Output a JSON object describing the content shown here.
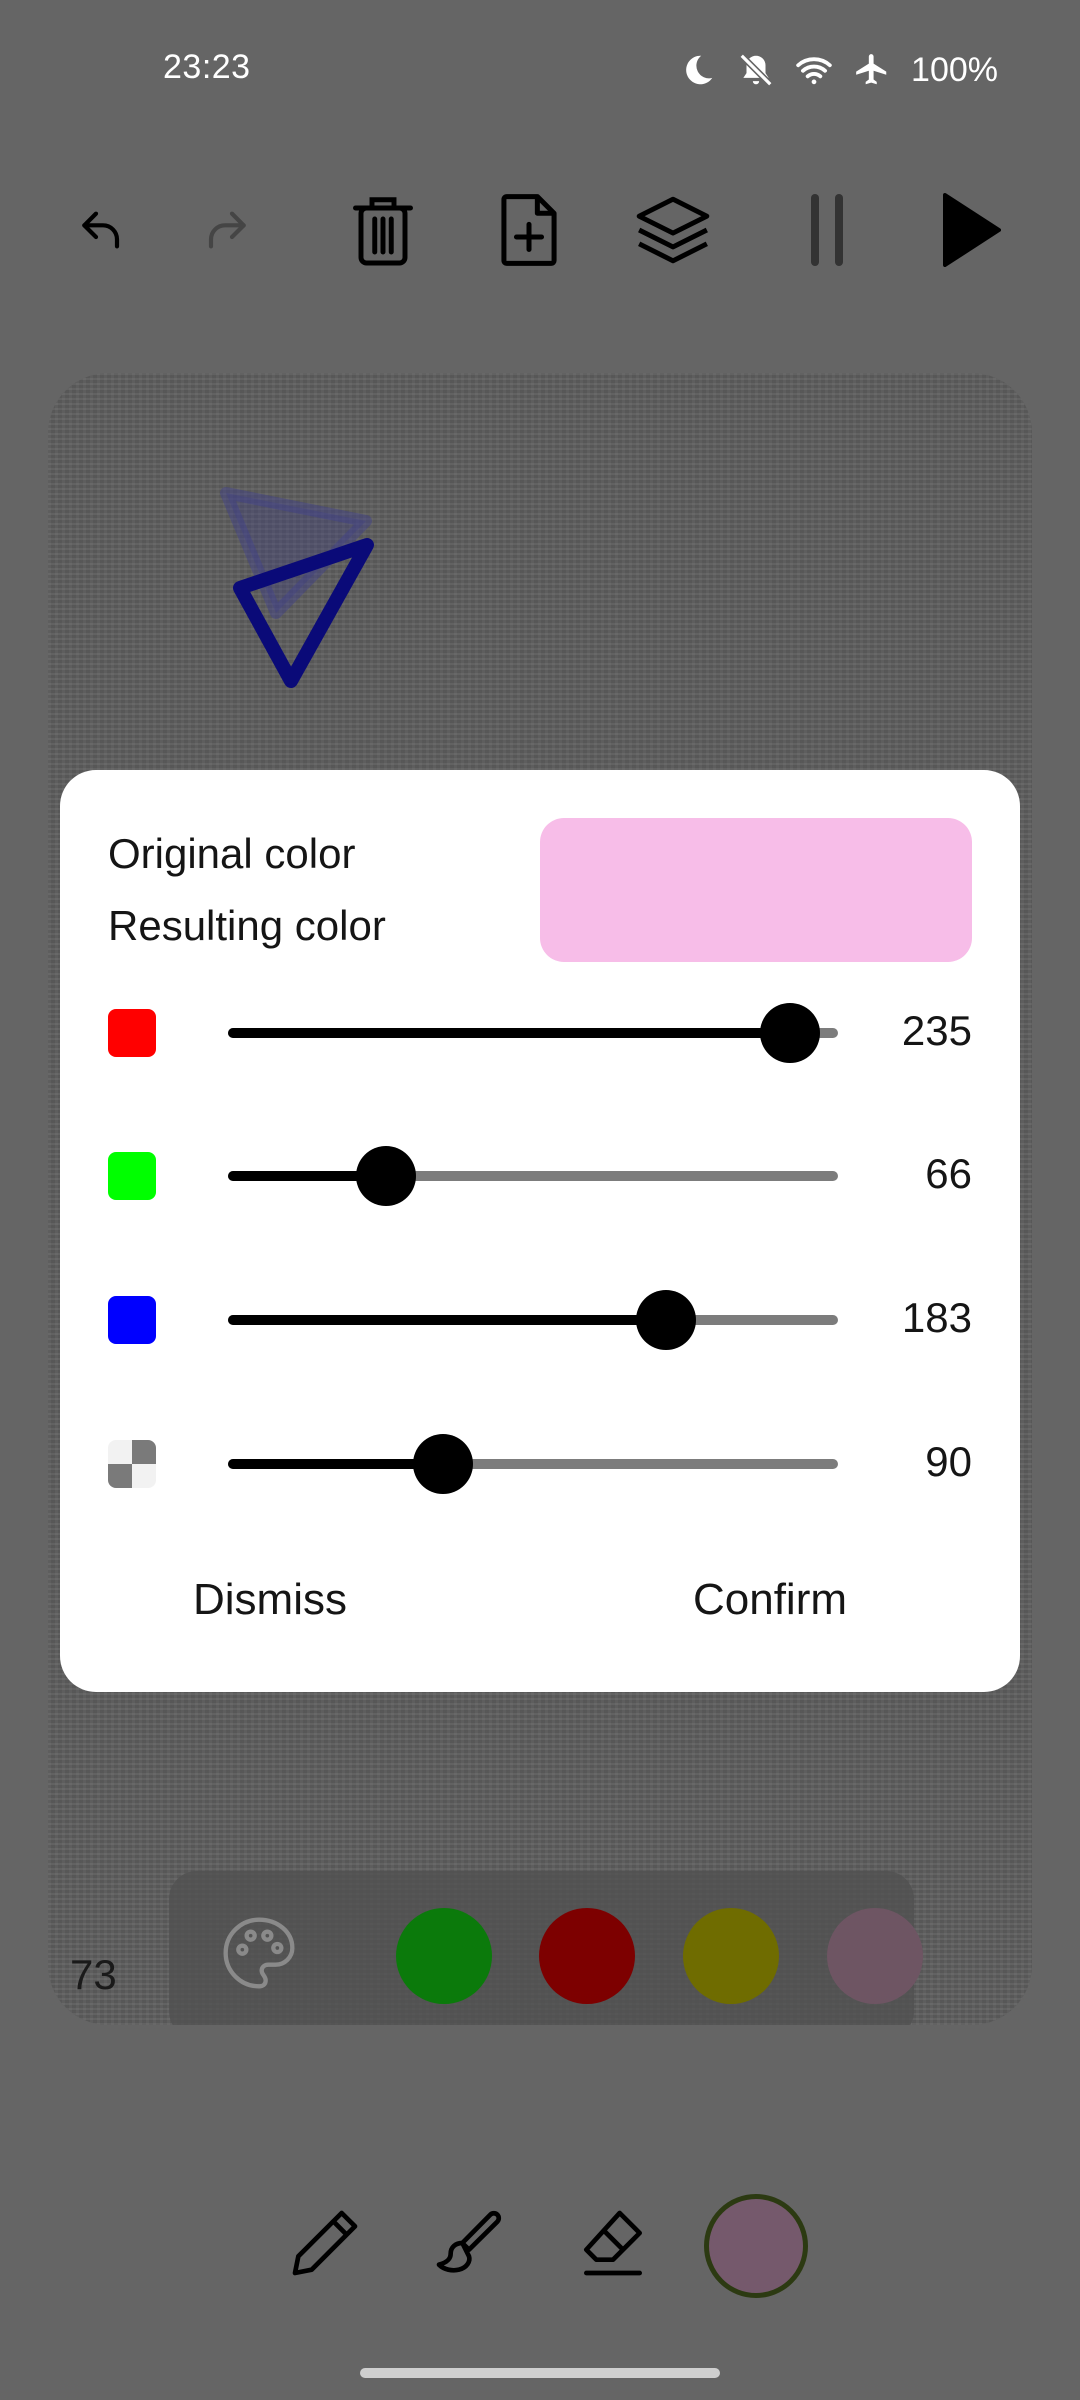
{
  "status_bar": {
    "time": "23:23",
    "battery": "100%",
    "icons": [
      "moon-icon",
      "bell-off-icon",
      "wifi-icon",
      "airplane-icon"
    ]
  },
  "toolbar": {
    "icons": [
      "undo-icon",
      "redo-icon",
      "trash-icon",
      "new-page-icon",
      "layers-icon",
      "pause-icon",
      "play-icon"
    ]
  },
  "canvas": {
    "counter": "73",
    "palette": {
      "icon": "palette-icon",
      "swatches": [
        "#0b7a0b",
        "#7d0000",
        "#6f6c00",
        "#6e5563"
      ]
    }
  },
  "dialog": {
    "original_label": "Original color",
    "resulting_label": "Resulting color",
    "preview_color": "#f7bde8",
    "channels": [
      {
        "name": "red",
        "color": "#ff0000",
        "value": 235,
        "max": 255
      },
      {
        "name": "green",
        "color": "#00ff00",
        "value": 66,
        "max": 255
      },
      {
        "name": "blue",
        "color": "#0000ff",
        "value": 183,
        "max": 255
      },
      {
        "name": "alpha",
        "color": "checker",
        "value": 90,
        "max": 255
      }
    ],
    "dismiss_label": "Dismiss",
    "confirm_label": "Confirm"
  },
  "bottom_tools": {
    "icons": [
      "pencil-icon",
      "brush-icon",
      "eraser-icon"
    ],
    "current_color": "#75596c"
  }
}
